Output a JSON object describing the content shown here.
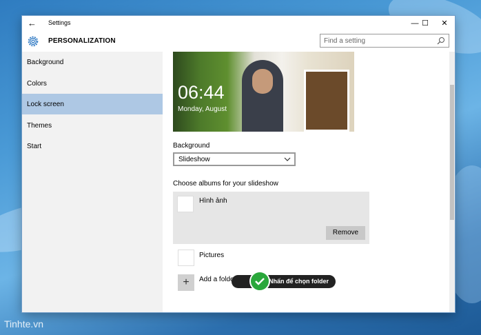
{
  "window": {
    "title": "Settings",
    "back_icon": "back-arrow-icon",
    "controls": {
      "minimize": "—",
      "maximize": "☐",
      "close": "✕"
    }
  },
  "header": {
    "section_title": "PERSONALIZATION",
    "section_icon": "gear-icon",
    "search_placeholder": "Find a setting",
    "search_icon": "search-icon"
  },
  "sidebar": {
    "items": [
      {
        "label": "Background",
        "active": false
      },
      {
        "label": "Colors",
        "active": false
      },
      {
        "label": "Lock screen",
        "active": true
      },
      {
        "label": "Themes",
        "active": false
      },
      {
        "label": "Start",
        "active": false
      }
    ]
  },
  "preview": {
    "time": "06:44",
    "date": "Monday, August"
  },
  "background": {
    "label": "Background",
    "selected": "Slideshow",
    "dropdown_icon": "chevron-down-icon"
  },
  "albums": {
    "label": "Choose albums for your slideshow",
    "items": [
      {
        "name": "Hình ảnh",
        "selected": true
      },
      {
        "name": "Pictures",
        "selected": false
      }
    ],
    "remove_label": "Remove",
    "add_label": "Add a folder",
    "add_icon": "plus-icon"
  },
  "callout": {
    "text": "Nhấn để chọn folder",
    "icon": "checkmark-icon",
    "color": "#2aa73b"
  },
  "watermark": "Tinhte.vn",
  "colors": {
    "accent": "#aec8e4",
    "sidebar_bg": "#f2f2f2"
  }
}
